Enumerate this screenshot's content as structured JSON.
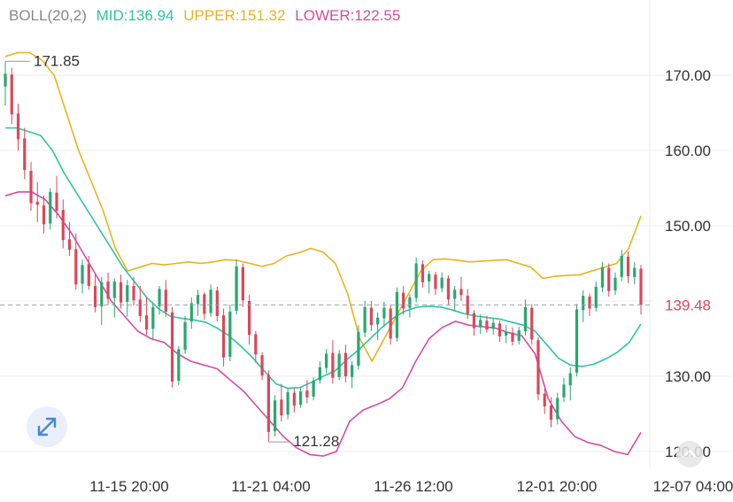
{
  "legend": {
    "indicator": "BOLL(20,2)",
    "mid_label": "MID:",
    "mid_value": "136.94",
    "upper_label": "UPPER:",
    "upper_value": "151.32",
    "lower_label": "LOWER:",
    "lower_value": "122.55"
  },
  "colors": {
    "up": "#27a86f",
    "down": "#d9485c",
    "mid": "#2ec4a6",
    "upper": "#eab31c",
    "lower": "#d54ca6",
    "grid": "#eeeeee",
    "axis_text": "#333333",
    "price_line": "#9aa3ad",
    "price_tag": "#d9485c"
  },
  "icons": {
    "expand": "expand-diagonal-arrows-icon",
    "corner": "chevron-up-circle-icon"
  },
  "chart_data": {
    "type": "candlestick",
    "indicator": "Bollinger Bands (20,2)",
    "y_axis": {
      "ticks": [
        "170.00",
        "160.00",
        "150.00",
        "140.00",
        "130.00",
        "120.00"
      ],
      "range": [
        117.5,
        177.5
      ],
      "position": "right"
    },
    "x_axis": {
      "ticks": [
        "11-15 20:00",
        "11-21 04:00",
        "11-26 12:00",
        "12-01 20:00",
        "12-07 04:00"
      ]
    },
    "current_price": "139.48",
    "high_marker": {
      "label": "171.85",
      "value": 171.85
    },
    "low_marker": {
      "label": "121.28",
      "value": 121.28
    },
    "candles": [
      {
        "o": 168.5,
        "h": 171.85,
        "l": 166.0,
        "c": 170.2
      },
      {
        "o": 170.1,
        "h": 171.0,
        "l": 163.5,
        "c": 164.8
      },
      {
        "o": 164.9,
        "h": 166.2,
        "l": 160.0,
        "c": 161.5
      },
      {
        "o": 161.6,
        "h": 163.0,
        "l": 156.2,
        "c": 157.4
      },
      {
        "o": 157.3,
        "h": 158.5,
        "l": 152.0,
        "c": 153.0
      },
      {
        "o": 153.2,
        "h": 155.8,
        "l": 150.5,
        "c": 152.8
      },
      {
        "o": 152.7,
        "h": 154.0,
        "l": 149.0,
        "c": 150.2
      },
      {
        "o": 150.3,
        "h": 155.0,
        "l": 149.5,
        "c": 154.5
      },
      {
        "o": 154.4,
        "h": 156.6,
        "l": 151.0,
        "c": 152.0
      },
      {
        "o": 152.1,
        "h": 153.5,
        "l": 147.0,
        "c": 148.1
      },
      {
        "o": 148.2,
        "h": 150.5,
        "l": 146.0,
        "c": 146.8
      },
      {
        "o": 146.9,
        "h": 149.0,
        "l": 141.5,
        "c": 142.2
      },
      {
        "o": 142.3,
        "h": 145.5,
        "l": 141.0,
        "c": 144.8
      },
      {
        "o": 144.9,
        "h": 146.0,
        "l": 141.5,
        "c": 142.0
      },
      {
        "o": 142.0,
        "h": 143.5,
        "l": 138.5,
        "c": 139.2
      },
      {
        "o": 139.3,
        "h": 143.2,
        "l": 136.8,
        "c": 142.5
      },
      {
        "o": 142.6,
        "h": 143.8,
        "l": 139.5,
        "c": 140.3
      },
      {
        "o": 140.4,
        "h": 143.0,
        "l": 137.8,
        "c": 142.6
      },
      {
        "o": 142.5,
        "h": 143.5,
        "l": 139.0,
        "c": 139.8
      },
      {
        "o": 139.9,
        "h": 142.8,
        "l": 137.9,
        "c": 142.1
      },
      {
        "o": 142.0,
        "h": 143.2,
        "l": 139.4,
        "c": 140.1
      },
      {
        "o": 140.2,
        "h": 142.0,
        "l": 137.2,
        "c": 138.0
      },
      {
        "o": 138.1,
        "h": 140.5,
        "l": 135.5,
        "c": 136.2
      },
      {
        "o": 136.3,
        "h": 139.8,
        "l": 134.8,
        "c": 139.2
      },
      {
        "o": 139.3,
        "h": 142.0,
        "l": 138.2,
        "c": 141.6
      },
      {
        "o": 141.5,
        "h": 142.8,
        "l": 137.9,
        "c": 138.6
      },
      {
        "o": 138.5,
        "h": 139.2,
        "l": 128.5,
        "c": 129.3
      },
      {
        "o": 129.4,
        "h": 134.0,
        "l": 128.8,
        "c": 133.6
      },
      {
        "o": 133.5,
        "h": 138.0,
        "l": 133.0,
        "c": 137.2
      },
      {
        "o": 137.3,
        "h": 140.5,
        "l": 136.3,
        "c": 139.7
      },
      {
        "o": 139.6,
        "h": 141.5,
        "l": 138.0,
        "c": 140.8
      },
      {
        "o": 140.9,
        "h": 141.2,
        "l": 137.5,
        "c": 138.3
      },
      {
        "o": 138.4,
        "h": 142.2,
        "l": 137.9,
        "c": 141.5
      },
      {
        "o": 141.4,
        "h": 141.9,
        "l": 137.3,
        "c": 138.0
      },
      {
        "o": 138.1,
        "h": 139.0,
        "l": 131.3,
        "c": 132.5
      },
      {
        "o": 132.6,
        "h": 139.5,
        "l": 132.0,
        "c": 138.6
      },
      {
        "o": 138.7,
        "h": 145.5,
        "l": 138.2,
        "c": 144.6
      },
      {
        "o": 144.5,
        "h": 145.0,
        "l": 139.2,
        "c": 140.1
      },
      {
        "o": 140.0,
        "h": 140.8,
        "l": 134.2,
        "c": 135.5
      },
      {
        "o": 135.6,
        "h": 136.0,
        "l": 131.8,
        "c": 132.9
      },
      {
        "o": 132.8,
        "h": 133.2,
        "l": 129.5,
        "c": 130.1
      },
      {
        "o": 130.2,
        "h": 130.8,
        "l": 121.28,
        "c": 122.6
      },
      {
        "o": 122.7,
        "h": 127.5,
        "l": 122.0,
        "c": 126.8
      },
      {
        "o": 126.9,
        "h": 129.0,
        "l": 124.0,
        "c": 124.8
      },
      {
        "o": 124.9,
        "h": 128.5,
        "l": 124.3,
        "c": 127.9
      },
      {
        "o": 127.8,
        "h": 128.4,
        "l": 125.2,
        "c": 126.1
      },
      {
        "o": 126.2,
        "h": 128.6,
        "l": 125.8,
        "c": 128.0
      },
      {
        "o": 128.1,
        "h": 129.5,
        "l": 126.4,
        "c": 127.2
      },
      {
        "o": 127.3,
        "h": 129.9,
        "l": 126.8,
        "c": 129.4
      },
      {
        "o": 129.5,
        "h": 132.0,
        "l": 129.0,
        "c": 131.2
      },
      {
        "o": 131.1,
        "h": 133.6,
        "l": 130.4,
        "c": 133.0
      },
      {
        "o": 133.1,
        "h": 134.8,
        "l": 129.0,
        "c": 129.8
      },
      {
        "o": 129.9,
        "h": 133.5,
        "l": 129.5,
        "c": 133.0
      },
      {
        "o": 133.1,
        "h": 134.2,
        "l": 129.2,
        "c": 130.0
      },
      {
        "o": 129.9,
        "h": 132.0,
        "l": 128.4,
        "c": 131.5
      },
      {
        "o": 131.4,
        "h": 136.8,
        "l": 130.9,
        "c": 135.9
      },
      {
        "o": 135.8,
        "h": 140.0,
        "l": 135.2,
        "c": 139.2
      },
      {
        "o": 139.1,
        "h": 140.0,
        "l": 136.0,
        "c": 136.8
      },
      {
        "o": 136.9,
        "h": 138.5,
        "l": 134.8,
        "c": 137.8
      },
      {
        "o": 137.7,
        "h": 139.9,
        "l": 136.6,
        "c": 139.1
      },
      {
        "o": 139.0,
        "h": 139.5,
        "l": 134.2,
        "c": 135.0
      },
      {
        "o": 135.1,
        "h": 141.8,
        "l": 134.6,
        "c": 141.2
      },
      {
        "o": 141.1,
        "h": 142.0,
        "l": 138.2,
        "c": 139.0
      },
      {
        "o": 139.1,
        "h": 140.9,
        "l": 137.8,
        "c": 140.5
      },
      {
        "o": 140.4,
        "h": 145.8,
        "l": 139.8,
        "c": 145.0
      },
      {
        "o": 144.9,
        "h": 145.4,
        "l": 141.8,
        "c": 142.5
      },
      {
        "o": 142.6,
        "h": 144.0,
        "l": 141.0,
        "c": 143.6
      },
      {
        "o": 143.5,
        "h": 143.9,
        "l": 140.8,
        "c": 141.6
      },
      {
        "o": 141.7,
        "h": 143.8,
        "l": 141.2,
        "c": 143.1
      },
      {
        "o": 143.0,
        "h": 143.4,
        "l": 139.4,
        "c": 140.2
      },
      {
        "o": 140.3,
        "h": 142.0,
        "l": 138.6,
        "c": 141.5
      },
      {
        "o": 141.6,
        "h": 143.2,
        "l": 140.0,
        "c": 140.8
      },
      {
        "o": 140.7,
        "h": 141.6,
        "l": 137.6,
        "c": 138.3
      },
      {
        "o": 138.4,
        "h": 138.8,
        "l": 135.4,
        "c": 136.4
      },
      {
        "o": 136.5,
        "h": 138.2,
        "l": 135.6,
        "c": 137.5
      },
      {
        "o": 137.4,
        "h": 138.0,
        "l": 135.8,
        "c": 136.2
      },
      {
        "o": 136.3,
        "h": 137.6,
        "l": 135.5,
        "c": 137.1
      },
      {
        "o": 137.0,
        "h": 137.4,
        "l": 134.6,
        "c": 135.3
      },
      {
        "o": 135.4,
        "h": 136.8,
        "l": 134.4,
        "c": 135.9
      },
      {
        "o": 135.8,
        "h": 136.5,
        "l": 134.1,
        "c": 134.6
      },
      {
        "o": 134.7,
        "h": 136.6,
        "l": 134.2,
        "c": 136.1
      },
      {
        "o": 136.0,
        "h": 140.2,
        "l": 135.4,
        "c": 139.2
      },
      {
        "o": 139.1,
        "h": 139.6,
        "l": 134.2,
        "c": 134.9
      },
      {
        "o": 134.8,
        "h": 135.2,
        "l": 126.8,
        "c": 127.6
      },
      {
        "o": 127.7,
        "h": 128.4,
        "l": 125.0,
        "c": 126.0
      },
      {
        "o": 126.1,
        "h": 127.2,
        "l": 123.2,
        "c": 124.2
      },
      {
        "o": 124.3,
        "h": 127.8,
        "l": 123.6,
        "c": 127.1
      },
      {
        "o": 127.2,
        "h": 129.8,
        "l": 126.6,
        "c": 128.9
      },
      {
        "o": 128.8,
        "h": 131.2,
        "l": 126.8,
        "c": 130.4
      },
      {
        "o": 130.5,
        "h": 139.6,
        "l": 130.0,
        "c": 138.9
      },
      {
        "o": 138.8,
        "h": 141.4,
        "l": 137.2,
        "c": 140.7
      },
      {
        "o": 140.6,
        "h": 141.0,
        "l": 138.0,
        "c": 139.0
      },
      {
        "o": 139.1,
        "h": 142.6,
        "l": 138.6,
        "c": 141.9
      },
      {
        "o": 141.8,
        "h": 145.2,
        "l": 141.2,
        "c": 144.5
      },
      {
        "o": 144.4,
        "h": 145.0,
        "l": 140.6,
        "c": 141.3
      },
      {
        "o": 141.4,
        "h": 143.8,
        "l": 140.8,
        "c": 143.1
      },
      {
        "o": 143.2,
        "h": 146.8,
        "l": 142.6,
        "c": 146.0
      },
      {
        "o": 145.9,
        "h": 146.6,
        "l": 142.4,
        "c": 143.3
      },
      {
        "o": 143.2,
        "h": 145.2,
        "l": 142.2,
        "c": 144.4
      },
      {
        "o": 144.3,
        "h": 144.8,
        "l": 138.2,
        "c": 139.48
      }
    ],
    "series": [
      {
        "name": "UPPER",
        "values": [
          172.5,
          173.0,
          173.0,
          172.0,
          170.0,
          165.0,
          160.0,
          156.0,
          152.0,
          147.0,
          144.0,
          144.5,
          145.0,
          144.8,
          145.0,
          145.2,
          145.0,
          145.2,
          145.5,
          145.4,
          145.0,
          144.6,
          145.0,
          146.0,
          146.4,
          147.0,
          146.5,
          145.0,
          141.0,
          135.0,
          132.0,
          135.0,
          138.0,
          141.0,
          144.0,
          145.5,
          145.6,
          145.4,
          145.2,
          145.3,
          145.4,
          145.5,
          145.0,
          144.5,
          143.0,
          143.3,
          143.4,
          143.5,
          144.0,
          144.5,
          145.0,
          147.0,
          151.32
        ]
      },
      {
        "name": "MID",
        "values": [
          163.0,
          163.0,
          162.5,
          162.0,
          160.0,
          157.0,
          154.5,
          152.0,
          149.5,
          147.0,
          144.5,
          142.5,
          140.5,
          139.0,
          138.0,
          137.7,
          137.5,
          137.2,
          136.4,
          135.4,
          134.0,
          132.5,
          130.7,
          129.0,
          128.4,
          128.5,
          129.2,
          130.0,
          130.7,
          132.2,
          133.5,
          135.0,
          136.5,
          137.8,
          138.7,
          139.2,
          139.3,
          139.2,
          138.8,
          138.3,
          138.0,
          137.8,
          137.6,
          137.2,
          136.8,
          136.0,
          134.2,
          132.4,
          131.5,
          131.3,
          131.6,
          132.3,
          133.2,
          134.5,
          136.94
        ]
      },
      {
        "name": "LOWER",
        "values": [
          154.0,
          154.5,
          154.5,
          153.5,
          151.5,
          149.0,
          146.0,
          143.0,
          140.0,
          138.0,
          136.0,
          135.0,
          134.5,
          133.0,
          132.0,
          131.5,
          131.0,
          129.5,
          128.0,
          126.0,
          124.0,
          122.0,
          120.5,
          119.6,
          119.4,
          120.0,
          124.0,
          125.5,
          126.2,
          127.0,
          128.5,
          132.0,
          135.0,
          136.5,
          137.3,
          136.8,
          136.6,
          136.4,
          135.8,
          135.4,
          133.0,
          127.0,
          124.0,
          122.0,
          121.2,
          120.8,
          120.0,
          119.6,
          122.55
        ]
      }
    ]
  }
}
